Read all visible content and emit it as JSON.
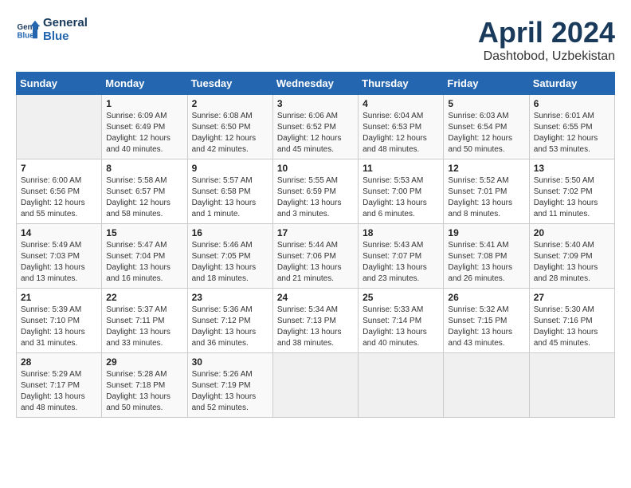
{
  "header": {
    "logo_line1": "General",
    "logo_line2": "Blue",
    "month_year": "April 2024",
    "location": "Dashtobod, Uzbekistan"
  },
  "weekdays": [
    "Sunday",
    "Monday",
    "Tuesday",
    "Wednesday",
    "Thursday",
    "Friday",
    "Saturday"
  ],
  "weeks": [
    [
      {
        "day": "",
        "sunrise": "",
        "sunset": "",
        "daylight": ""
      },
      {
        "day": "1",
        "sunrise": "6:09 AM",
        "sunset": "6:49 PM",
        "daylight": "12 hours and 40 minutes."
      },
      {
        "day": "2",
        "sunrise": "6:08 AM",
        "sunset": "6:50 PM",
        "daylight": "12 hours and 42 minutes."
      },
      {
        "day": "3",
        "sunrise": "6:06 AM",
        "sunset": "6:52 PM",
        "daylight": "12 hours and 45 minutes."
      },
      {
        "day": "4",
        "sunrise": "6:04 AM",
        "sunset": "6:53 PM",
        "daylight": "12 hours and 48 minutes."
      },
      {
        "day": "5",
        "sunrise": "6:03 AM",
        "sunset": "6:54 PM",
        "daylight": "12 hours and 50 minutes."
      },
      {
        "day": "6",
        "sunrise": "6:01 AM",
        "sunset": "6:55 PM",
        "daylight": "12 hours and 53 minutes."
      }
    ],
    [
      {
        "day": "7",
        "sunrise": "6:00 AM",
        "sunset": "6:56 PM",
        "daylight": "12 hours and 55 minutes."
      },
      {
        "day": "8",
        "sunrise": "5:58 AM",
        "sunset": "6:57 PM",
        "daylight": "12 hours and 58 minutes."
      },
      {
        "day": "9",
        "sunrise": "5:57 AM",
        "sunset": "6:58 PM",
        "daylight": "13 hours and 1 minute."
      },
      {
        "day": "10",
        "sunrise": "5:55 AM",
        "sunset": "6:59 PM",
        "daylight": "13 hours and 3 minutes."
      },
      {
        "day": "11",
        "sunrise": "5:53 AM",
        "sunset": "7:00 PM",
        "daylight": "13 hours and 6 minutes."
      },
      {
        "day": "12",
        "sunrise": "5:52 AM",
        "sunset": "7:01 PM",
        "daylight": "13 hours and 8 minutes."
      },
      {
        "day": "13",
        "sunrise": "5:50 AM",
        "sunset": "7:02 PM",
        "daylight": "13 hours and 11 minutes."
      }
    ],
    [
      {
        "day": "14",
        "sunrise": "5:49 AM",
        "sunset": "7:03 PM",
        "daylight": "13 hours and 13 minutes."
      },
      {
        "day": "15",
        "sunrise": "5:47 AM",
        "sunset": "7:04 PM",
        "daylight": "13 hours and 16 minutes."
      },
      {
        "day": "16",
        "sunrise": "5:46 AM",
        "sunset": "7:05 PM",
        "daylight": "13 hours and 18 minutes."
      },
      {
        "day": "17",
        "sunrise": "5:44 AM",
        "sunset": "7:06 PM",
        "daylight": "13 hours and 21 minutes."
      },
      {
        "day": "18",
        "sunrise": "5:43 AM",
        "sunset": "7:07 PM",
        "daylight": "13 hours and 23 minutes."
      },
      {
        "day": "19",
        "sunrise": "5:41 AM",
        "sunset": "7:08 PM",
        "daylight": "13 hours and 26 minutes."
      },
      {
        "day": "20",
        "sunrise": "5:40 AM",
        "sunset": "7:09 PM",
        "daylight": "13 hours and 28 minutes."
      }
    ],
    [
      {
        "day": "21",
        "sunrise": "5:39 AM",
        "sunset": "7:10 PM",
        "daylight": "13 hours and 31 minutes."
      },
      {
        "day": "22",
        "sunrise": "5:37 AM",
        "sunset": "7:11 PM",
        "daylight": "13 hours and 33 minutes."
      },
      {
        "day": "23",
        "sunrise": "5:36 AM",
        "sunset": "7:12 PM",
        "daylight": "13 hours and 36 minutes."
      },
      {
        "day": "24",
        "sunrise": "5:34 AM",
        "sunset": "7:13 PM",
        "daylight": "13 hours and 38 minutes."
      },
      {
        "day": "25",
        "sunrise": "5:33 AM",
        "sunset": "7:14 PM",
        "daylight": "13 hours and 40 minutes."
      },
      {
        "day": "26",
        "sunrise": "5:32 AM",
        "sunset": "7:15 PM",
        "daylight": "13 hours and 43 minutes."
      },
      {
        "day": "27",
        "sunrise": "5:30 AM",
        "sunset": "7:16 PM",
        "daylight": "13 hours and 45 minutes."
      }
    ],
    [
      {
        "day": "28",
        "sunrise": "5:29 AM",
        "sunset": "7:17 PM",
        "daylight": "13 hours and 48 minutes."
      },
      {
        "day": "29",
        "sunrise": "5:28 AM",
        "sunset": "7:18 PM",
        "daylight": "13 hours and 50 minutes."
      },
      {
        "day": "30",
        "sunrise": "5:26 AM",
        "sunset": "7:19 PM",
        "daylight": "13 hours and 52 minutes."
      },
      {
        "day": "",
        "sunrise": "",
        "sunset": "",
        "daylight": ""
      },
      {
        "day": "",
        "sunrise": "",
        "sunset": "",
        "daylight": ""
      },
      {
        "day": "",
        "sunrise": "",
        "sunset": "",
        "daylight": ""
      },
      {
        "day": "",
        "sunrise": "",
        "sunset": "",
        "daylight": ""
      }
    ]
  ]
}
